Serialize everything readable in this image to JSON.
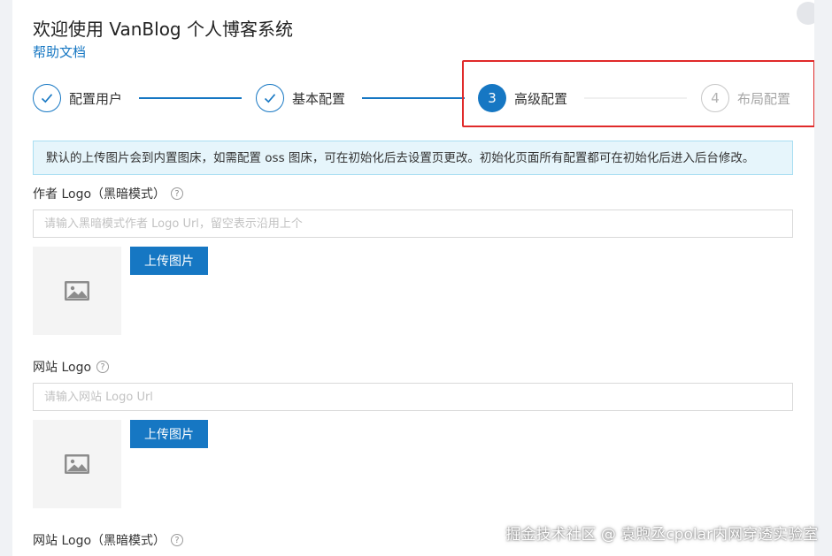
{
  "header": {
    "title": "欢迎使用 VanBlog 个人博客系统",
    "help_link": "帮助文档"
  },
  "steps": [
    {
      "number": "1",
      "label": "配置用户",
      "status": "done"
    },
    {
      "number": "2",
      "label": "基本配置",
      "status": "done"
    },
    {
      "number": "3",
      "label": "高级配置",
      "status": "active"
    },
    {
      "number": "4",
      "label": "布局配置",
      "status": "todo"
    }
  ],
  "alert": {
    "text": "默认的上传图片会到内置图床，如需配置 oss 图床，可在初始化后去设置页更改。初始化页面所有配置都可在初始化后进入后台修改。"
  },
  "fields": [
    {
      "label": "作者 Logo（黑暗模式）",
      "placeholder": "请输入黑暗模式作者 Logo Url，留空表示沿用上个",
      "value": "",
      "upload_label": "上传图片"
    },
    {
      "label": "网站 Logo",
      "placeholder": "请输入网站 Logo Url",
      "value": "",
      "upload_label": "上传图片"
    },
    {
      "label": "网站 Logo（黑暗模式）"
    }
  ],
  "watermark": "掘金技术社区 @ 袁煦丞cpolar内网穿透实验室",
  "colors": {
    "primary": "#1677c3",
    "highlight_border": "#e02a2a",
    "alert_background": "#e6f5fb",
    "alert_border": "#a8def2"
  },
  "icons": {
    "done_step": "check-icon",
    "help_tooltip": "question-circle-icon",
    "image_placeholder": "image-icon"
  }
}
